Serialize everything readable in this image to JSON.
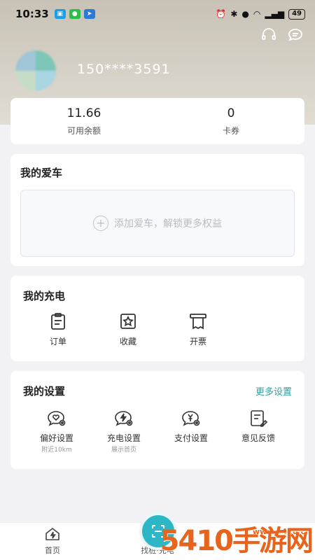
{
  "status_bar": {
    "time": "10:33",
    "battery": "49"
  },
  "profile": {
    "phone": "150****3591"
  },
  "balance": {
    "amount_value": "11.66",
    "amount_label": "可用余额",
    "coupon_value": "0",
    "coupon_label": "卡券"
  },
  "my_car": {
    "title": "我的爱车",
    "add_text": "添加爱车，解锁更多权益"
  },
  "my_charging": {
    "title": "我的充电",
    "items": [
      {
        "label": "订单",
        "icon": "order-clipboard-icon"
      },
      {
        "label": "收藏",
        "icon": "star-bookmark-icon"
      },
      {
        "label": "开票",
        "icon": "invoice-icon"
      }
    ]
  },
  "my_settings": {
    "title": "我的设置",
    "more_label": "更多设置",
    "items": [
      {
        "label": "偏好设置",
        "sub": "附近10km",
        "icon": "heart-chat-icon"
      },
      {
        "label": "充电设置",
        "sub": "展示首页",
        "icon": "bolt-chat-icon"
      },
      {
        "label": "支付设置",
        "sub": "",
        "icon": "yen-chat-icon"
      },
      {
        "label": "意见反馈",
        "sub": "",
        "icon": "feedback-edit-icon"
      }
    ]
  },
  "tabbar": {
    "home_label": "首页",
    "charge_label": "找桩·充电"
  },
  "watermark": {
    "text": "5410手游网",
    "small": "www.5410.cn"
  },
  "colors": {
    "accent": "#2aa3a3",
    "scan": "#2db7c6"
  }
}
